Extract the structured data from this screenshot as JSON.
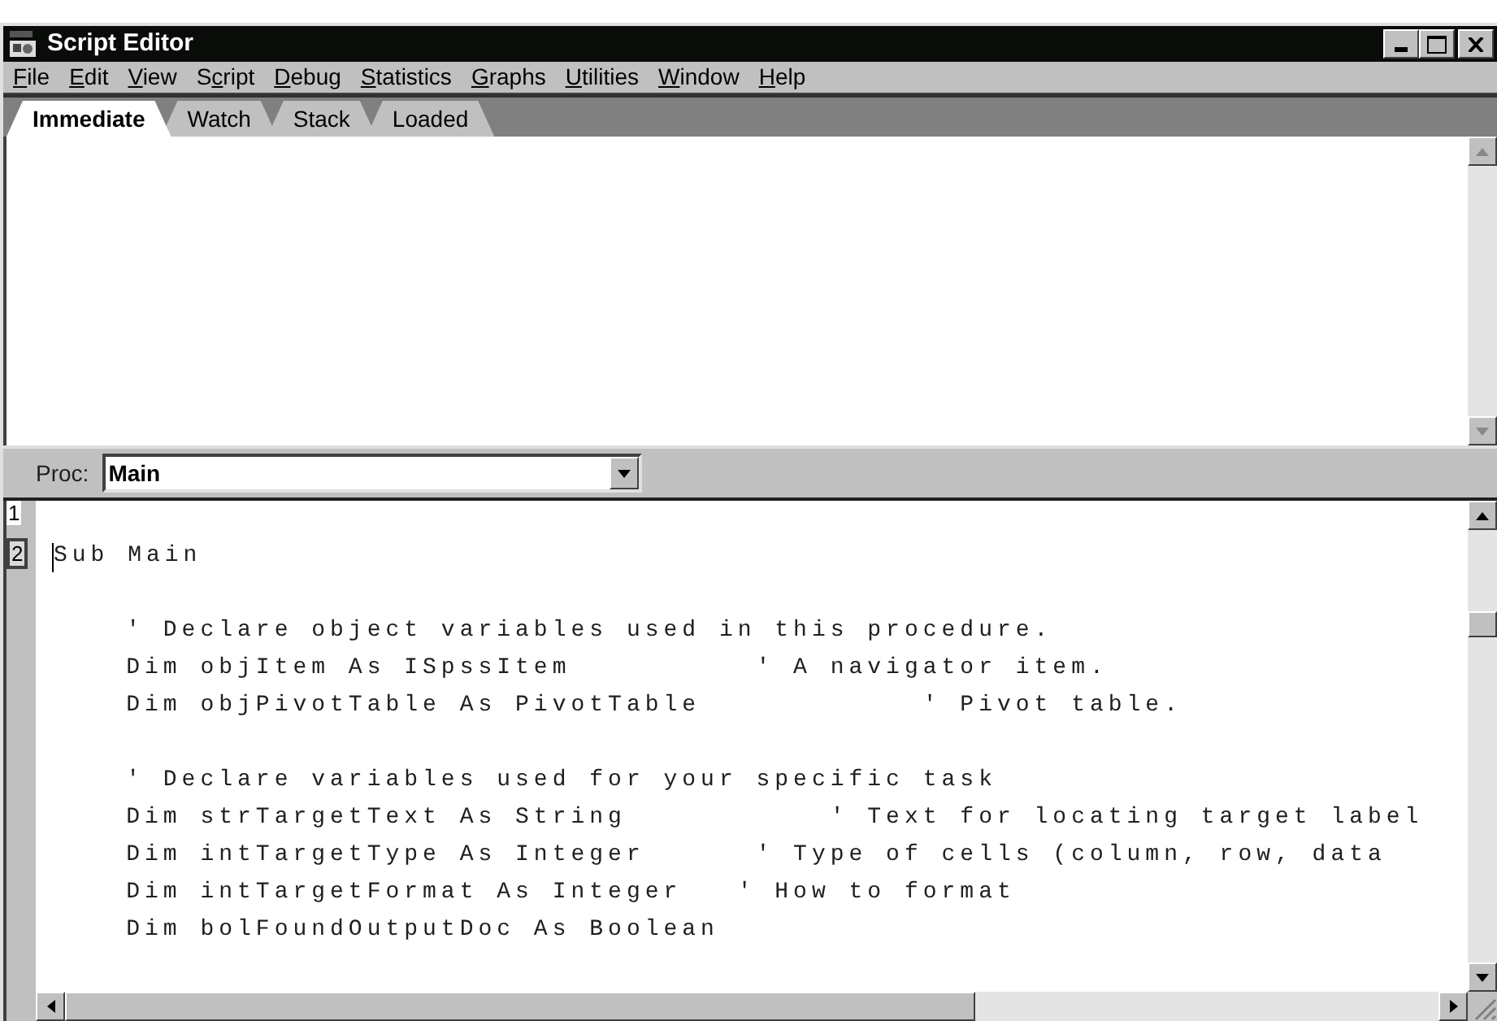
{
  "window": {
    "title": "Script Editor"
  },
  "menu": [
    {
      "key": "F",
      "post": "ile"
    },
    {
      "key": "E",
      "post": "dit"
    },
    {
      "key": "V",
      "post": "iew"
    },
    {
      "pre": "S",
      "key": "c",
      "post": "ript"
    },
    {
      "key": "D",
      "post": "ebug"
    },
    {
      "key": "S",
      "post": "tatistics"
    },
    {
      "key": "G",
      "post": "raphs"
    },
    {
      "key": "U",
      "post": "tilities"
    },
    {
      "key": "W",
      "post": "indow"
    },
    {
      "key": "H",
      "post": "elp"
    }
  ],
  "tabs": [
    {
      "label": "Immediate",
      "selected": true
    },
    {
      "label": "Watch",
      "selected": false
    },
    {
      "label": "Stack",
      "selected": false
    },
    {
      "label": "Loaded",
      "selected": false
    }
  ],
  "proc": {
    "label": "Proc:",
    "value": "Main"
  },
  "code_lines": [
    {
      "kind": "code",
      "number": "1",
      "selected": false
    },
    {
      "kind": "code",
      "number": "2",
      "selected": true,
      "text": "Sub Main",
      "cursor": true
    },
    {
      "kind": "blank"
    },
    {
      "kind": "code",
      "text": "    ' Declare object variables used in this procedure."
    },
    {
      "kind": "code",
      "text": "    Dim objItem As ISpssItem          ' A navigator item."
    },
    {
      "kind": "code",
      "text": "    Dim objPivotTable As PivotTable            ' Pivot table."
    },
    {
      "kind": "blank"
    },
    {
      "kind": "code",
      "text": "    ' Declare variables used for your specific task"
    },
    {
      "kind": "code",
      "text": "    Dim strTargetText As String           ' Text for locating target label"
    },
    {
      "kind": "code",
      "text": "    Dim intTargetType As Integer      ' Type of cells (column, row, data"
    },
    {
      "kind": "code",
      "text": "    Dim intTargetFormat As Integer   ' How to format"
    },
    {
      "kind": "code",
      "text": "    Dim bolFoundOutputDoc As Boolean"
    }
  ]
}
